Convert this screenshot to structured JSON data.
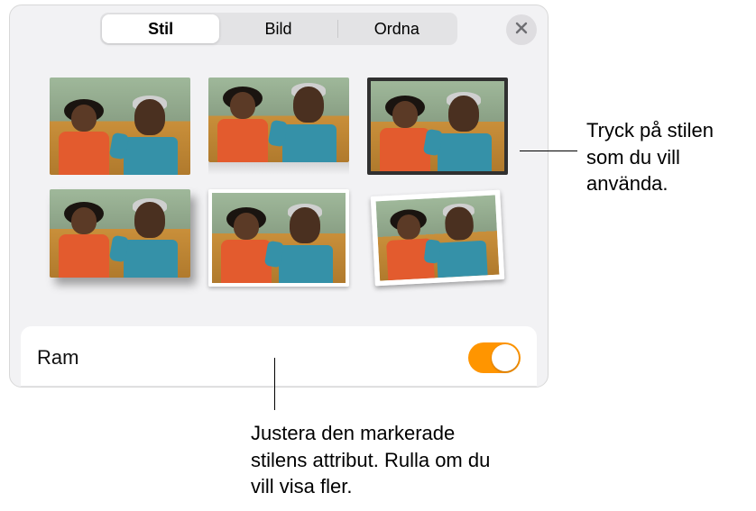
{
  "header": {
    "tabs": [
      {
        "label": "Stil",
        "active": true
      },
      {
        "label": "Bild",
        "active": false
      },
      {
        "label": "Ordna",
        "active": false
      }
    ]
  },
  "styles": {
    "items": [
      {
        "name": "plain"
      },
      {
        "name": "reflection"
      },
      {
        "name": "black-border"
      },
      {
        "name": "drop-shadow"
      },
      {
        "name": "white-border"
      },
      {
        "name": "tilted-photo"
      }
    ]
  },
  "attributes": {
    "frame_label": "Ram",
    "frame_on": true
  },
  "callouts": {
    "style_hint": "Tryck på stilen som du vill använda.",
    "attributes_hint": "Justera den markerade stilens attribut. Rulla om du vill visa fler."
  },
  "colors": {
    "accent": "#ff9500"
  }
}
